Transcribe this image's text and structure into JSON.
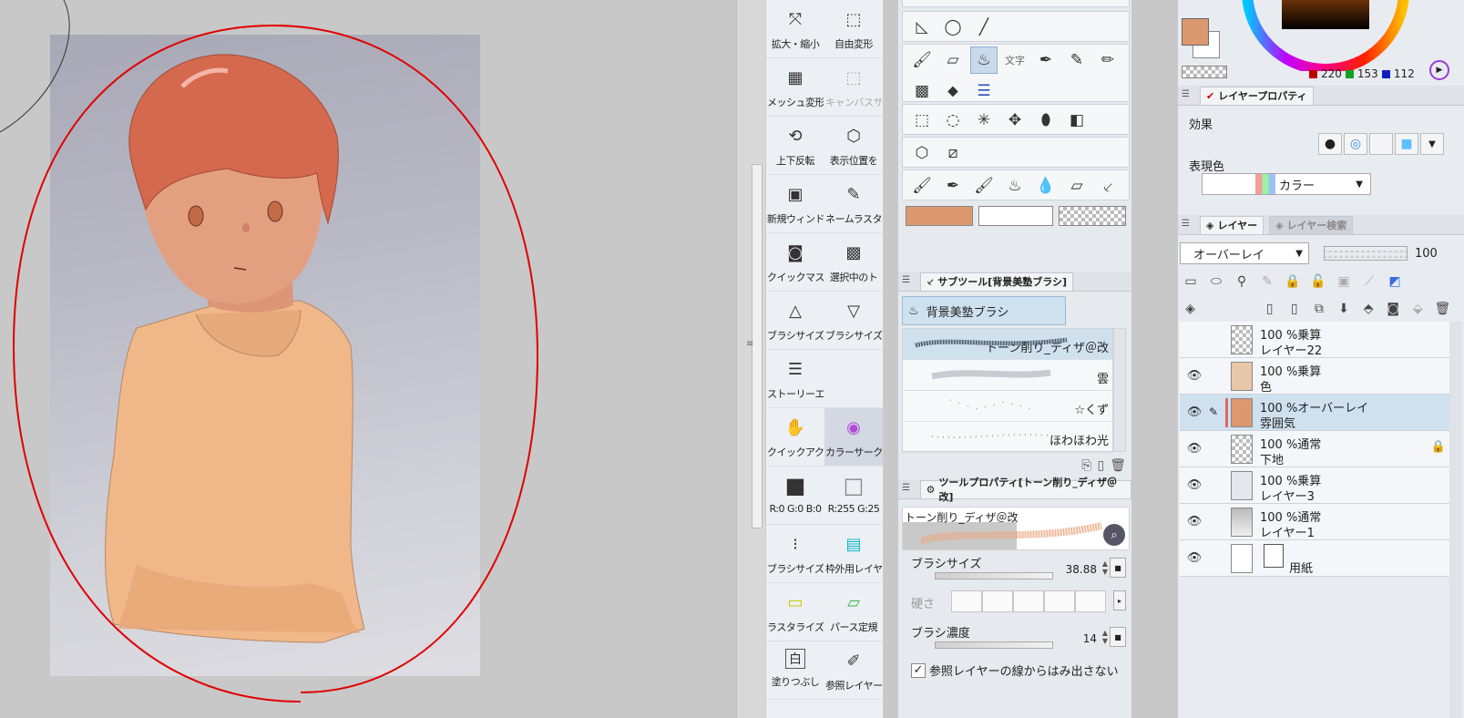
{
  "colors": {
    "main": "#DC9970",
    "sub": "#FFFFFF",
    "accent_red": "#E00000",
    "selection_blue": "#CFE1EF"
  },
  "command_bar": {
    "items": [
      {
        "label": "拡大・縮小",
        "icon": "scale-icon",
        "glyph": "⤧"
      },
      {
        "label": "自由変形",
        "icon": "free-transform-icon",
        "glyph": "⬚"
      },
      {
        "label": "メッシュ変形",
        "icon": "mesh-transform-icon",
        "glyph": "▦"
      },
      {
        "label": "キャンバスサ",
        "icon": "canvas-size-icon",
        "glyph": "⬚",
        "disabled": true
      },
      {
        "label": "上下反転",
        "icon": "flip-vertical-icon",
        "glyph": "⟲"
      },
      {
        "label": "表示位置を",
        "icon": "reset-view-icon",
        "glyph": "⬡"
      },
      {
        "label": "新規ウィンド",
        "icon": "new-window-icon",
        "glyph": "▣"
      },
      {
        "label": "ネームラスタ",
        "icon": "name-rasterize-icon",
        "glyph": "✎"
      },
      {
        "label": "クイックマスク",
        "icon": "quick-mask-icon",
        "glyph": "◙"
      },
      {
        "label": "選択中のト",
        "icon": "select-tone-icon",
        "glyph": "▩"
      },
      {
        "label": "ブラシサイズを",
        "icon": "brush-size-up-icon",
        "glyph": "△"
      },
      {
        "label": "ブラシサイズを",
        "icon": "brush-size-down-icon",
        "glyph": "▽"
      },
      {
        "label": "ストーリーエデ",
        "icon": "story-editor-icon",
        "glyph": "☰"
      },
      {
        "label": "",
        "icon": "blank-icon",
        "glyph": ""
      },
      {
        "label": "クイックアクセ",
        "icon": "quick-access-icon",
        "glyph": "✋"
      },
      {
        "label": "カラーサーク",
        "icon": "color-circle-icon",
        "glyph": "◉",
        "active": true
      },
      {
        "label": "R:0 G:0 B:0",
        "icon": "black-color-icon",
        "glyph": "■"
      },
      {
        "label": "R:255 G:25",
        "icon": "white-color-icon",
        "glyph": "□"
      },
      {
        "label": "ブラシサイズ",
        "icon": "brush-size-icon",
        "glyph": "⁝"
      },
      {
        "label": "枠外用レイヤ",
        "icon": "outside-frame-layer-icon",
        "glyph": "▤"
      },
      {
        "label": "ラスタライズ",
        "icon": "rasterize-icon",
        "glyph": "▭"
      },
      {
        "label": "パース定規",
        "icon": "perspective-ruler-icon",
        "glyph": "▱"
      },
      {
        "label": "塗りつぶし",
        "icon": "fill-icon",
        "glyph": "白"
      },
      {
        "label": "参照レイヤー",
        "icon": "reference-layer-icon",
        "glyph": "✐"
      }
    ]
  },
  "tool_panel": {
    "subtool_tab": "サブツール[背景美塾ブラシ]",
    "subtool_group": "背景美塾ブラシ",
    "brushes": [
      {
        "name": "トーン削り_ディザ＠改",
        "selected": true
      },
      {
        "name": "雲",
        "selected": false
      },
      {
        "name": "☆くず",
        "selected": false
      },
      {
        "name": "ほわほわ光",
        "selected": false
      }
    ],
    "tool_property_tab": "ツールプロパティ[トーン削り_ディザ＠改]",
    "preview_name": "トーン削り_ディザ＠改",
    "brush_size_label": "ブラシサイズ",
    "brush_size_value": "38.88",
    "hardness_label": "硬さ",
    "density_label": "ブラシ濃度",
    "density_value": "14",
    "ref_checkbox_label": "参照レイヤーの線からはみ出さない"
  },
  "color_panel": {
    "r": "220",
    "g": "153",
    "b": "112"
  },
  "layer_property": {
    "tab": "レイヤープロパティ",
    "effect_label": "効果",
    "expression_label": "表現色",
    "expression_value": "カラー"
  },
  "layer_panel": {
    "tab_layer": "レイヤー",
    "tab_search": "レイヤー検索",
    "blend_mode": "オーバーレイ",
    "opacity": "100",
    "layers": [
      {
        "mode": "100 %乗算",
        "name": "レイヤー22",
        "visible": false,
        "thumb": "#dcdcdc"
      },
      {
        "mode": "100 %乗算",
        "name": "色",
        "visible": true,
        "thumb": "#e8c7a8"
      },
      {
        "mode": "100 %オーバーレイ",
        "name": "雰囲気",
        "visible": true,
        "selected": true,
        "thumb": "#DC9970"
      },
      {
        "mode": "100 %通常",
        "name": "下地",
        "visible": true,
        "thumb": "#e2e2e2",
        "locked": true
      },
      {
        "mode": "100 %乗算",
        "name": "レイヤー3",
        "visible": true,
        "thumb": "#e6e6ef"
      },
      {
        "mode": "100 %通常",
        "name": "レイヤー1",
        "visible": true,
        "thumb": "#c8c8c8"
      },
      {
        "mode": "",
        "name": "用紙",
        "visible": true,
        "paper": true,
        "thumb": "#ffffff"
      }
    ]
  }
}
